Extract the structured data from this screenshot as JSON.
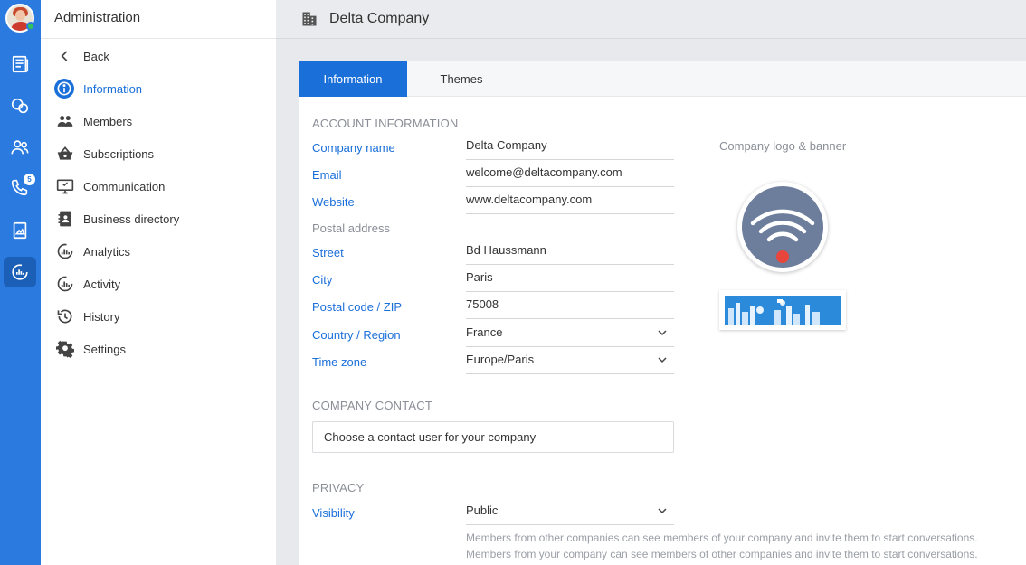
{
  "sidebar": {
    "title": "Administration",
    "items": [
      {
        "label": "Back",
        "icon": "chevron-left-icon"
      },
      {
        "label": "Information",
        "icon": "info-icon"
      },
      {
        "label": "Members",
        "icon": "people-icon"
      },
      {
        "label": "Subscriptions",
        "icon": "basket-icon"
      },
      {
        "label": "Communication",
        "icon": "monitor-icon"
      },
      {
        "label": "Business directory",
        "icon": "contact-book-icon"
      },
      {
        "label": "Analytics",
        "icon": "analytics-icon"
      },
      {
        "label": "Activity",
        "icon": "activity-icon"
      },
      {
        "label": "History",
        "icon": "history-icon"
      },
      {
        "label": "Settings",
        "icon": "gear-icon"
      }
    ]
  },
  "rail": {
    "badge_count": "5",
    "icons": [
      "news-icon",
      "bubbles-icon",
      "contacts-icon",
      "phone-icon",
      "document-icon",
      "admin-analytics-icon"
    ]
  },
  "header": {
    "company_name": "Delta Company",
    "icon": "building-icon"
  },
  "tabs": [
    {
      "label": "Information"
    },
    {
      "label": "Themes"
    }
  ],
  "account": {
    "section_title": "ACCOUNT INFORMATION",
    "company_name_label": "Company name",
    "company_name": "Delta Company",
    "email_label": "Email",
    "email": "welcome@deltacompany.com",
    "website_label": "Website",
    "website": "www.deltacompany.com",
    "postal_title": "Postal address",
    "street_label": "Street",
    "street": "Bd Haussmann",
    "city_label": "City",
    "city": "Paris",
    "zip_label": "Postal code / ZIP",
    "zip": "75008",
    "country_label": "Country / Region",
    "country": "France",
    "timezone_label": "Time zone",
    "timezone": "Europe/Paris"
  },
  "logo": {
    "title": "Company logo & banner"
  },
  "contact": {
    "section_title": "COMPANY CONTACT",
    "placeholder": "Choose a contact user for your company"
  },
  "privacy": {
    "section_title": "PRIVACY",
    "visibility_label": "Visibility",
    "visibility": "Public",
    "hint_1": "Members from other companies can see members of your company and invite them to start conversations.",
    "hint_2": "Members from your company can see members of other companies and invite them to start conversations."
  },
  "colors": {
    "rail": "#2b7ae0",
    "accent": "#1a6fd9",
    "label": "#1a6fd9",
    "muted": "#8a8e96"
  }
}
